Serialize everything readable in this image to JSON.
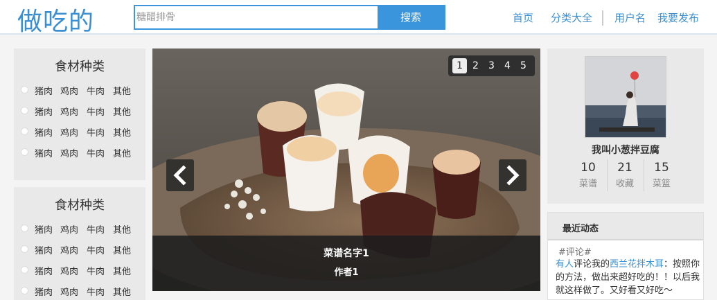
{
  "header": {
    "logo": "做吃的",
    "search_placeholder": "糖醋排骨",
    "search_button": "搜索",
    "nav": [
      "首页",
      "分类大全",
      "用户名",
      "我要发布"
    ]
  },
  "sidebar": {
    "panels": [
      {
        "title": "食材种类",
        "rows": [
          [
            "猪肉",
            "鸡肉",
            "牛肉",
            "其他"
          ],
          [
            "猪肉",
            "鸡肉",
            "牛肉",
            "其他"
          ],
          [
            "猪肉",
            "鸡肉",
            "牛肉",
            "其他"
          ],
          [
            "猪肉",
            "鸡肉",
            "牛肉",
            "其他"
          ]
        ]
      },
      {
        "title": "食材种类",
        "rows": [
          [
            "猪肉",
            "鸡肉",
            "牛肉",
            "其他"
          ],
          [
            "猪肉",
            "鸡肉",
            "牛肉",
            "其他"
          ],
          [
            "猪肉",
            "鸡肉",
            "牛肉",
            "其他"
          ],
          [
            "猪肉",
            "鸡肉",
            "牛肉",
            "其他"
          ]
        ]
      }
    ]
  },
  "carousel": {
    "pages": [
      "1",
      "2",
      "3",
      "4",
      "5"
    ],
    "active_page": 1,
    "recipe_name": "菜谱名字1",
    "author": "作者1"
  },
  "profile": {
    "name": "我叫小葱拌豆腐",
    "stats": [
      {
        "value": "10",
        "label": "菜谱"
      },
      {
        "value": "21",
        "label": "收藏"
      },
      {
        "value": "15",
        "label": "菜篮"
      }
    ]
  },
  "activity": {
    "title": "最近动态",
    "tag": "#评论#",
    "actor": "有人",
    "verb": "评论我的",
    "recipe": "西兰花拌木耳",
    "comment": "：按照你的方法，做出来超好吃的！！以后我就这样做了。又好看又好吃～"
  },
  "colors": {
    "accent": "#3b95dc",
    "link": "#3b8fd1",
    "panel_bg": "#e9e9e9"
  }
}
